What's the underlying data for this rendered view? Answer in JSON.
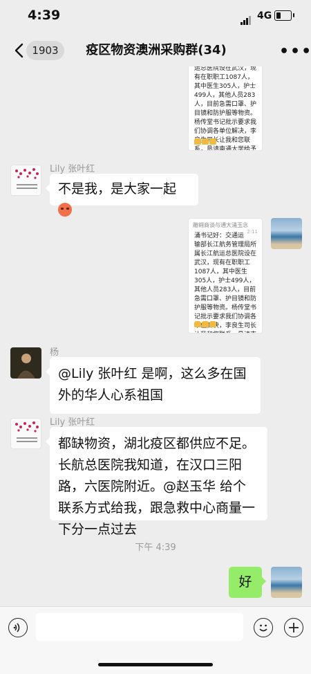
{
  "status_bar": {
    "time": "4:39",
    "network": "4G",
    "battery_level": 0.3
  },
  "nav": {
    "back_count": "1903",
    "title": "疫区物资澳洲采购群(34)",
    "more_icon": "more-icon"
  },
  "image_message_text": {
    "header_name": "雕翱商谈与通大涌玉念",
    "header_time": "2:11",
    "opening": "涌书记好：交通运输部长江航务管理局所属长江航运总医院设在武汉，现有在职职工1087人，其中医生305人，护士499人，其他人员283人，目前急需口罩、护目镜和防护服等物资。杨传堂书记批示要求我们协调各单位解决，李良生司长让我和您联系，恳请南通大学给予支持！后续费用按标准结算。谢谢，添麻烦了",
    "crop_visible": "运总医院设在武汉，现有在职职工1087人，其中医生305人，护士499人，其他人员283人，目前急需口罩、护目镜和防护服等物资。杨传堂书记批示要求我们协调各单位解决，李良生司长让我和您联系，恳请南通大学给予支持！后续费用按标准结算。谢谢，添麻烦了"
  },
  "messages": {
    "lily_name": "Lily 张叶红",
    "lily_msg1": "不是我，是大家一起",
    "yang_name": "杨",
    "yang_msg": "@Lily 张叶红 是啊，这么多在国外的华人心系祖国",
    "lily_msg2": "都缺物资，湖北疫区都供应不足。长航总医院我知道，在汉口三阳路，六医院附近。@赵玉华 给个联系方式给我，跟急救中心商量一下分一点过去",
    "timestamp": "下午 4:39",
    "self_msg": "好"
  },
  "input": {
    "placeholder": ""
  },
  "icons": [
    "back-icon",
    "voice-icon",
    "emoji-icon",
    "plus-icon",
    "more-icon"
  ]
}
